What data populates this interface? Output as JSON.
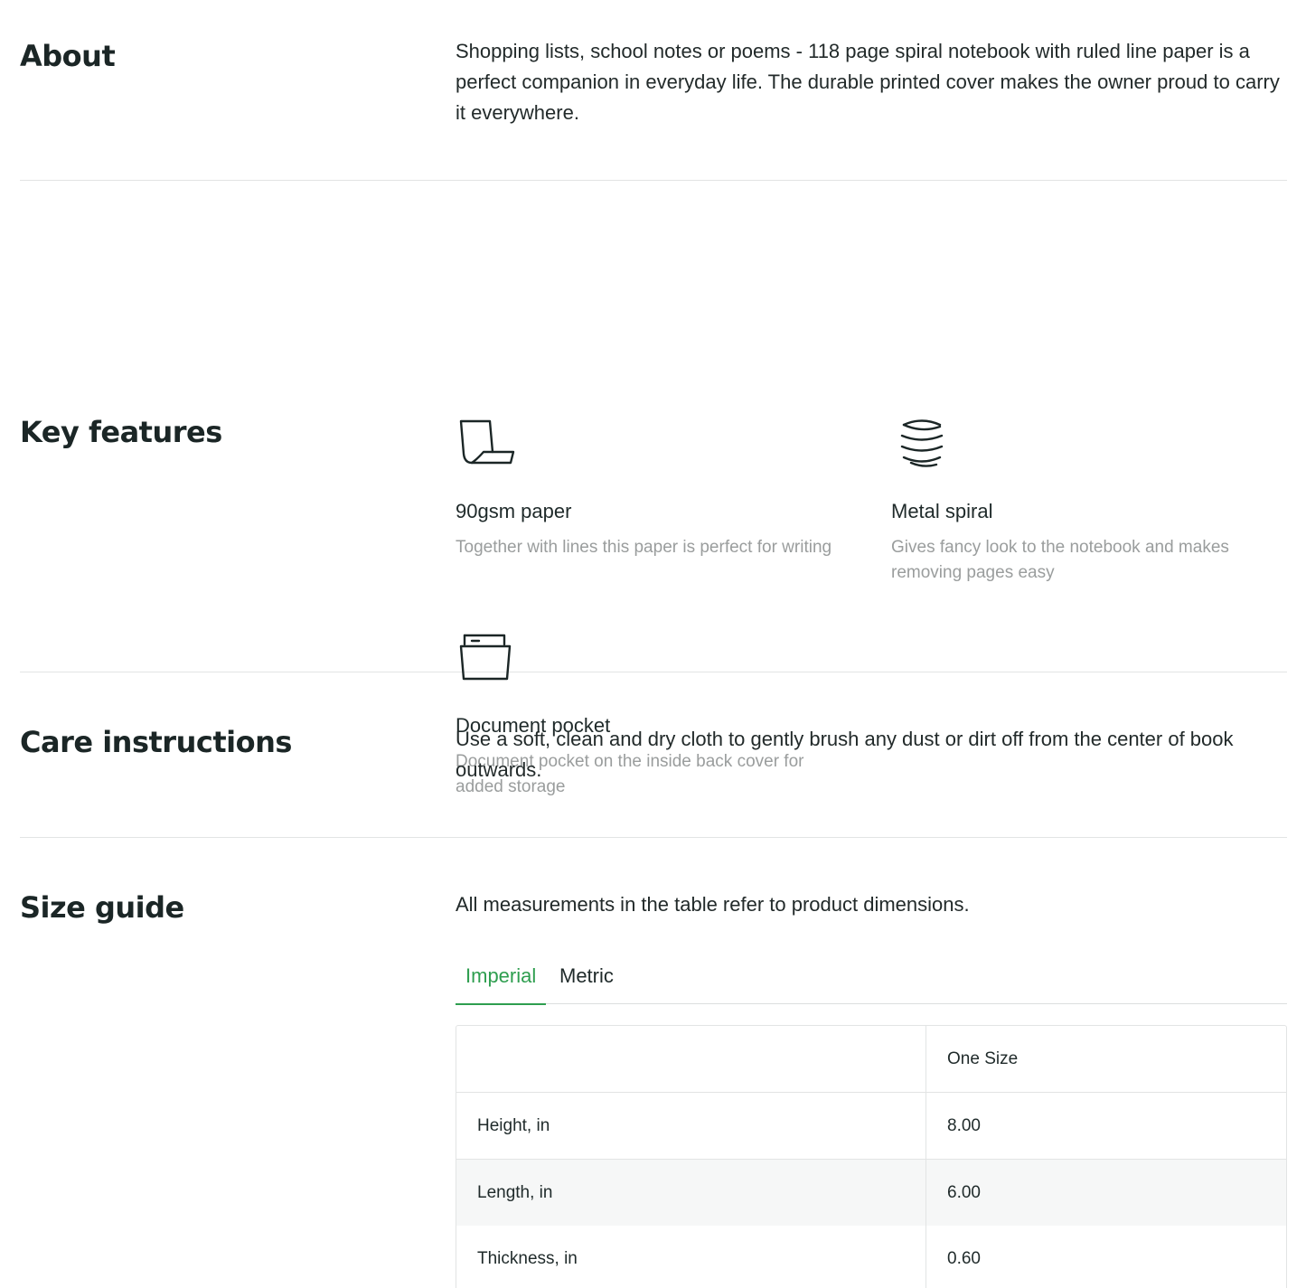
{
  "about": {
    "title": "About",
    "text": "Shopping lists, school notes or poems - 118 page spiral notebook with ruled line paper is a perfect companion in everyday life. The durable printed cover makes the owner proud to carry it everywhere."
  },
  "features": {
    "title": "Key features",
    "items": [
      {
        "icon": "paper-icon",
        "title": "90gsm paper",
        "desc": "Together with lines this paper is perfect for writing"
      },
      {
        "icon": "spiral-icon",
        "title": "Metal spiral",
        "desc": "Gives fancy look to the notebook and makes removing pages easy"
      },
      {
        "icon": "pocket-icon",
        "title": "Document pocket",
        "desc": "Document pocket on the inside back cover for added storage"
      }
    ]
  },
  "care": {
    "title": "Care instructions",
    "text": "Use a soft, clean and dry cloth to gently brush any dust or dirt off from the center of book outwards."
  },
  "size_guide": {
    "title": "Size guide",
    "intro": "All measurements in the table refer to product dimensions.",
    "tabs": [
      {
        "label": "Imperial",
        "active": true
      },
      {
        "label": "Metric",
        "active": false
      }
    ],
    "accent_color": "#2e9e4f",
    "table": {
      "header": [
        "",
        "One Size"
      ],
      "rows": [
        [
          "Height, in",
          "8.00"
        ],
        [
          "Length, in",
          "6.00"
        ],
        [
          "Thickness, in",
          "0.60"
        ]
      ]
    }
  }
}
